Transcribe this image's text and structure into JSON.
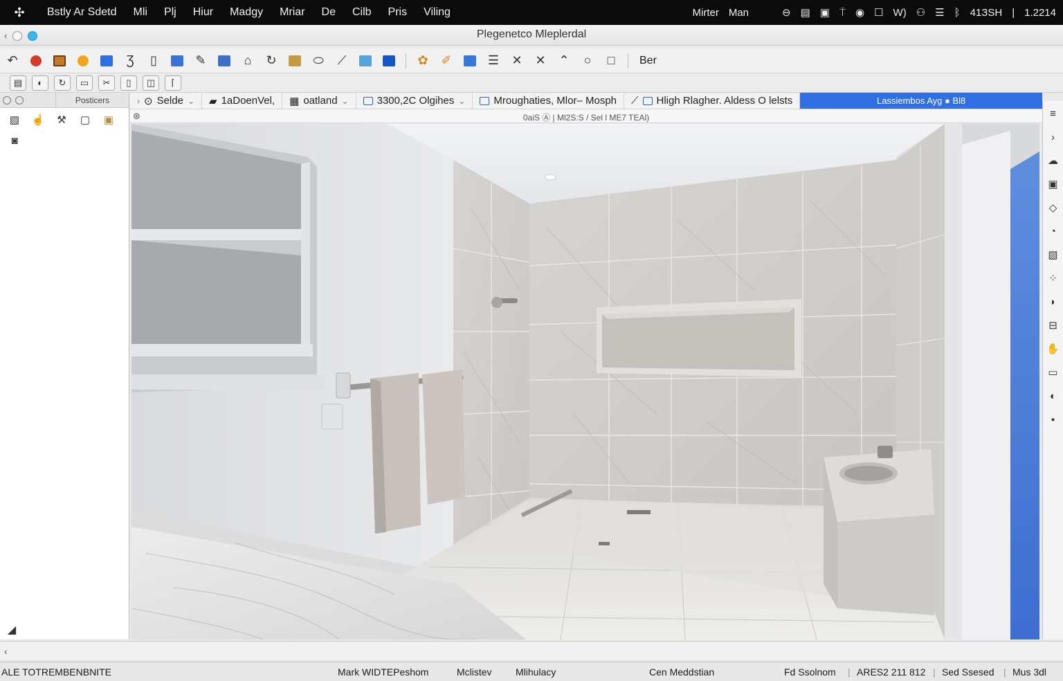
{
  "menubar": {
    "items": [
      "Bstly Ar Sdetd",
      "Mli",
      "Plj",
      "Hiur",
      "Madgy",
      "Mriar",
      "De",
      "Cilb",
      "Pris",
      "Viling"
    ],
    "right_items": [
      "Mirter",
      "Man"
    ],
    "clock": "41ЗSH",
    "date": "1.2214",
    "separator": "|"
  },
  "window": {
    "title": "Plegenetco Mleplerdal"
  },
  "toolbar": {
    "label": "Ber"
  },
  "left_panel": {
    "title": "Posticers"
  },
  "tabs": [
    {
      "label": "Selde"
    },
    {
      "label": "1aDoenVel,"
    },
    {
      "label": "oatland"
    },
    {
      "label": "3300,2C Olgihes"
    },
    {
      "label": "Mroughaties, Mlor– Mosph"
    },
    {
      "label": "Hligh Rlagher. Aldess O lelsts"
    },
    {
      "label": "Lassiembos Ayg ● Bl8"
    }
  ],
  "viewport": {
    "info": "0aiS Ⓐ | Ml2S:S / Sel l ME7 TEAl)"
  },
  "statusbar": {
    "left": "ALE TOTREMBENBNITE",
    "mid1": "Mark WIDTEPeshom",
    "mid2": "Mclistev",
    "mid3": "Mlihulacy",
    "center": "Cen Meddstian",
    "r1": "Fd Ssolnom",
    "r2": "ARES2 211 812",
    "r3": "Sed Ssesed",
    "r4": "Mus 3dl"
  },
  "colors": {
    "accent": "#2f6fe3",
    "menubar": "#0b0b0b"
  }
}
